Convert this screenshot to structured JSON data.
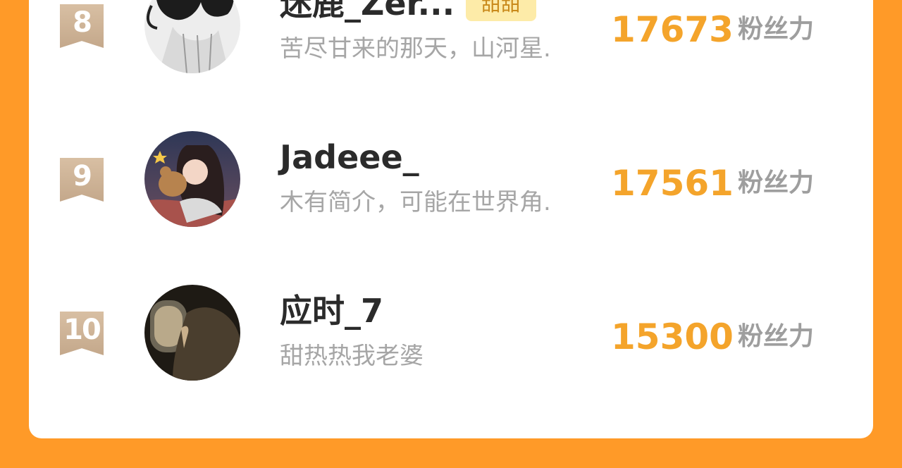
{
  "leaderboard": {
    "unit_label": "粉丝力",
    "entries": [
      {
        "rank": "8",
        "name": "迷鹿_Zer...",
        "tag": "甜甜",
        "bio": "苦尽甘来的那天，山河星.",
        "score": "17673",
        "avatar": "avatar-girl-dark-hair"
      },
      {
        "rank": "9",
        "name": "Jadeee_",
        "bio": "木有简介，可能在世界角.",
        "score": "17561",
        "avatar": "avatar-anime-girl-teddy-bear"
      },
      {
        "rank": "10",
        "name": "应时_7",
        "bio": "甜热热我老婆",
        "score": "15300",
        "avatar": "avatar-plane-window-photo"
      }
    ]
  },
  "colors": {
    "background": "#FF9A28",
    "score": "#F4A42B",
    "rank_badge": "#C9AE91",
    "tag_bg": "#FDEBA8"
  }
}
